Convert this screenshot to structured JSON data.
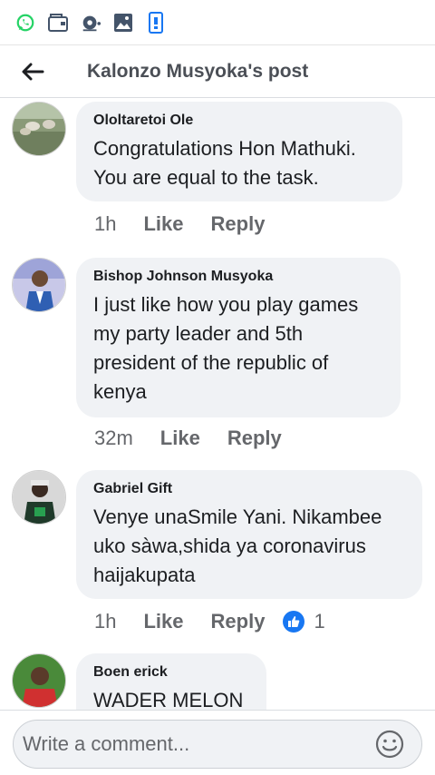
{
  "statusbar": {
    "icons": [
      "whatsapp-icon",
      "wallet-icon",
      "cast-icon",
      "image-icon",
      "phone-icon"
    ]
  },
  "header": {
    "title": "Kalonzo Musyoka's post"
  },
  "comments": [
    {
      "author": "Ololtaretoi Ole",
      "lines": [
        "Congratulations Hon Mathuki.",
        "You are equal to the task."
      ],
      "time": "1h",
      "like_label": "Like",
      "reply_label": "Reply"
    },
    {
      "author": "Bishop Johnson Musyoka",
      "lines": [
        "I just like how you play games",
        "my party leader and 5th",
        "president of the republic of",
        "kenya"
      ],
      "time": "32m",
      "like_label": "Like",
      "reply_label": "Reply"
    },
    {
      "author": "Gabriel Gift",
      "lines": [
        "Venye unaSmile Yani. Nikambee",
        "uko sàwa,shida ya coronavirus",
        "haijakupata"
      ],
      "time": "1h",
      "like_label": "Like",
      "reply_label": "Reply",
      "reaction_count": "1"
    },
    {
      "author": "Boen erick",
      "lines": [
        "WADER MELON"
      ]
    }
  ],
  "composer": {
    "placeholder": "Write a comment..."
  },
  "colors": {
    "accent": "#1877f2",
    "whatsapp": "#25d366",
    "icon_dark": "#44546a",
    "bubble": "#f0f2f5"
  }
}
